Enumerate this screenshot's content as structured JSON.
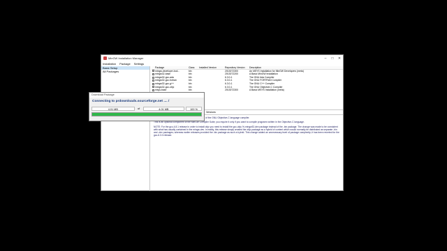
{
  "window": {
    "title": "MinGW Installation Manager",
    "controls": {
      "minimize": "–",
      "maximize": "□",
      "close": "✕"
    }
  },
  "menu": [
    "Installation",
    "Package",
    "Settings"
  ],
  "sidebar": {
    "items": [
      "Basic Setup",
      "All Packages"
    ],
    "selected": 0
  },
  "table": {
    "headers": [
      "",
      "Package",
      "Class",
      "Installed Version",
      "Repository Version",
      "Description"
    ],
    "rows": [
      {
        "package": "mingw-developer-tool...",
        "class": "bin",
        "installed": "",
        "repo": "2013072300",
        "desc": "An MSYS Installation for MinGW Developers (meta)"
      },
      {
        "package": "mingw32-base",
        "class": "bin",
        "installed": "",
        "repo": "2013072200",
        "desc": "A Basic MinGW Installation"
      },
      {
        "package": "mingw32-gcc-ada",
        "class": "bin",
        "installed": "",
        "repo": "6.3.0-1",
        "desc": "The GNU Ada Compiler"
      },
      {
        "package": "mingw32-gcc-fortran",
        "class": "bin",
        "installed": "",
        "repo": "6.3.0-1",
        "desc": "The GNU FORTRAN Compiler"
      },
      {
        "package": "mingw32-gcc-g++",
        "class": "bin",
        "installed": "",
        "repo": "6.3.0-1",
        "desc": "The GNU C++ Compiler"
      },
      {
        "package": "mingw32-gcc-objc",
        "class": "bin",
        "installed": "",
        "repo": "6.3.0-1",
        "desc": "The GNU Objective-C Compiler"
      },
      {
        "package": "msys-base",
        "class": "bin",
        "installed": "",
        "repo": "2013072300",
        "desc": "A Basic MSYS Installation (meta)"
      }
    ]
  },
  "tabs": [
    "Description",
    "Dependencies",
    "Installed Files",
    "Versions"
  ],
  "active_tab": 0,
  "description": [
    "The package provides the MinGW implementation of the GNU Objective-C language compiler.",
    "This is an optional component of the MinGW Compiler Suite; you require it only if you want to compile programs written in the Objective-C language.",
    "NOTE: For the gcc-4.8.1 release in order to install objc you need to install the gcc-objc-%-mingw32-dev package instead of the -bin package. The change was made to be consistent with what has usually contained in the mingw-dev. In reality, this release simply created the objc package as a hybrid of content which would normally be distributed as separate -bin and -dev packages; whereas earlier releases provided the -bin package as such a hybrid. This change added an unnecessary level of package complexity; it has been reverted for the gcc-6.3.0 release."
  ],
  "dialog": {
    "title": "Download Package",
    "message": "Connecting to prdownloads.sourceforge.net .... /",
    "downloaded": "4.01 MB",
    "of": "of",
    "total": "4.01 MB",
    "percent": "100 %",
    "progress": 1.0,
    "progress_color": "#2fb84a"
  }
}
